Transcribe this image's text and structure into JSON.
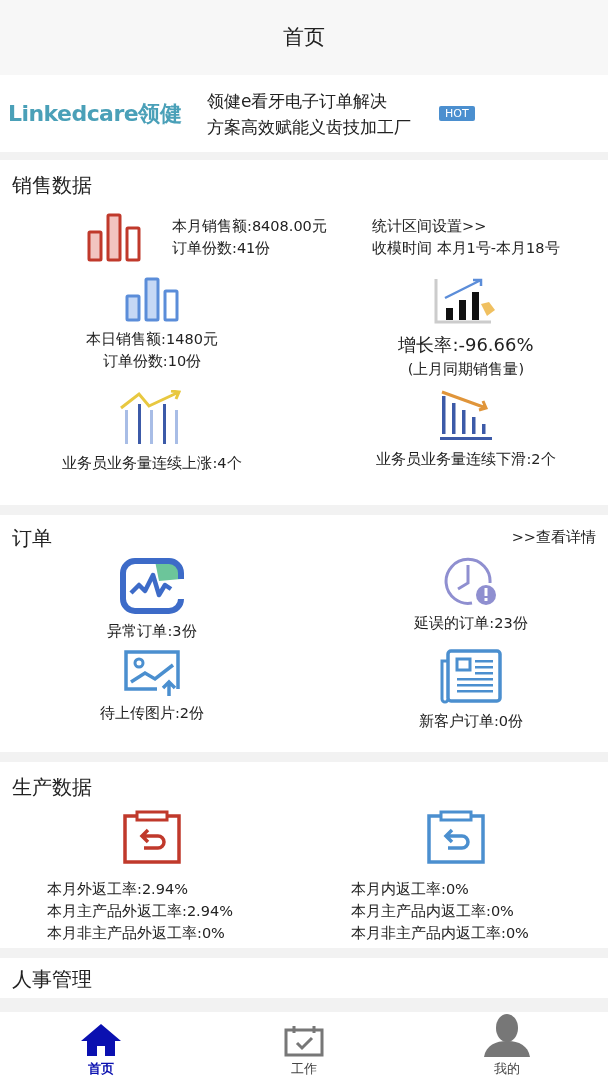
{
  "header": {
    "title": "首页"
  },
  "banner": {
    "logo_text": "Linkedcare",
    "logo_cn": "领健",
    "text_lines": [
      "领健e看牙电子订单解决",
      "方案高效赋能义齿技加工厂"
    ],
    "badge": "HOT"
  },
  "sales": {
    "title": "销售数据",
    "month_lines": [
      "本月销售额:8408.00元",
      "订单份数:41份"
    ],
    "settings_link": "统计区间设置>>",
    "period": "收模时间 本月1号-本月18号",
    "stats": [
      {
        "kind": "day",
        "lines": [
          "本日销售额:1480元",
          "订单份数:10份"
        ]
      },
      {
        "kind": "growth",
        "lines": [
          "增长率:-96.66%",
          "(上月同期销售量)"
        ]
      },
      {
        "kind": "rising",
        "lines": [
          "业务员业务量连续上涨:4个"
        ]
      },
      {
        "kind": "falling",
        "lines": [
          "业务员业务量连续下滑:2个"
        ]
      }
    ]
  },
  "orders": {
    "title": "订单",
    "link": ">>查看详情",
    "items": [
      {
        "kind": "abnormal",
        "label": "异常订单:3份"
      },
      {
        "kind": "delayed",
        "label": "延误的订单:23份"
      },
      {
        "kind": "upload",
        "label": "待上传图片:2份"
      },
      {
        "kind": "new_customer",
        "label": "新客户订单:0份"
      }
    ]
  },
  "production": {
    "title": "生产数据",
    "items": [
      {
        "kind": "external",
        "lines": [
          "本月外返工率:2.94%",
          "本月主产品外返工率:2.94%",
          "本月非主产品外返工率:0%"
        ]
      },
      {
        "kind": "internal",
        "lines": [
          "本月内返工率:0%",
          "本月主产品内返工率:0%",
          "本月非主产品内返工率:0%"
        ]
      }
    ]
  },
  "hr": {
    "title": "人事管理"
  },
  "tabs": [
    {
      "kind": "home",
      "label": "首页",
      "selected": true
    },
    {
      "kind": "work",
      "label": "工作",
      "selected": false
    },
    {
      "kind": "profile",
      "label": "我的",
      "selected": false
    }
  ]
}
